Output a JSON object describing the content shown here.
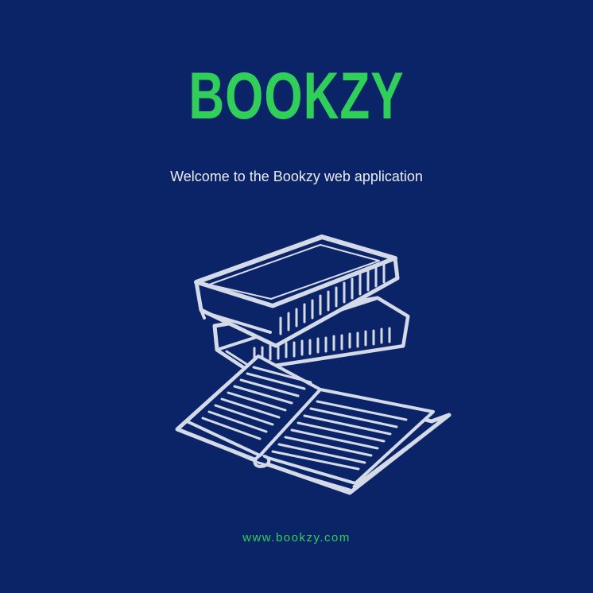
{
  "brand": {
    "logo_text": "BOOKZY"
  },
  "welcome": {
    "message": "Welcome to the Bookzy web application"
  },
  "footer": {
    "url_text": "www.bookzy.com"
  },
  "illustration": {
    "icon": "books-stack-open-book-icon"
  },
  "colors": {
    "background": "#0b2468",
    "accent": "#2fcf5a",
    "text": "#e9ecf5",
    "line_art": "#d4dae8"
  }
}
